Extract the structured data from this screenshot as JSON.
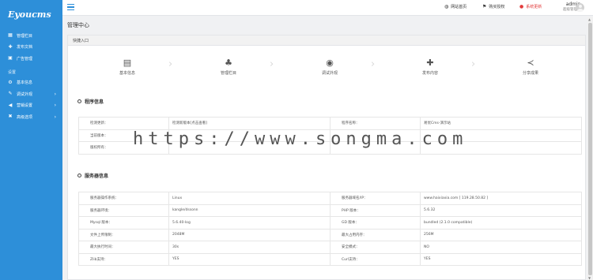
{
  "app": {
    "logo": "Eyoucms"
  },
  "sidebar": {
    "items": [
      {
        "label": "管理栏目",
        "icon": "grid-icon"
      },
      {
        "label": "发布文档",
        "icon": "plus-icon"
      },
      {
        "label": "广告管理",
        "icon": "image-icon"
      }
    ],
    "section_label": "设置",
    "settings": [
      {
        "label": "基本信息",
        "icon": "gear-icon"
      },
      {
        "label": "调试外观",
        "icon": "pen-icon"
      },
      {
        "label": "营销设置",
        "icon": "megaphone-icon"
      },
      {
        "label": "高级选项",
        "icon": "tools-icon"
      }
    ]
  },
  "topbar": {
    "home": "网站首页",
    "buy": "购买授权",
    "update": "系统更新",
    "user_name": "admin",
    "user_role": "超级管理员"
  },
  "main": {
    "title": "管理中心",
    "quick": {
      "heading": "快捷入口",
      "items": [
        {
          "label": "基本信息",
          "icon": "id-card-icon"
        },
        {
          "label": "管理栏目",
          "icon": "sitemap-icon"
        },
        {
          "label": "调试外观",
          "icon": "palette-icon"
        },
        {
          "label": "发布内容",
          "icon": "plus-icon"
        },
        {
          "label": "分享成果",
          "icon": "share-icon"
        }
      ]
    },
    "program": {
      "heading": "程序信息",
      "rows": [
        {
          "k1": "检测更新：",
          "v1": "检测新版本[点击查看]",
          "k2": "程序名称：",
          "v2": "易优Cms-演示站"
        },
        {
          "k1": "当前版本：",
          "v1": "",
          "k2": "",
          "v2": ""
        },
        {
          "k1": "版权所有：",
          "v1": "",
          "k2": "",
          "v2": ""
        }
      ]
    },
    "server": {
      "heading": "服务器信息",
      "rows": [
        {
          "k1": "服务器操作系统：",
          "v1": "Linux",
          "k2": "服务器域名/IP：",
          "v2": "www.haixiaxia.com [ 119.28.50.82 ]"
        },
        {
          "k1": "服务器环境：",
          "v1": "kangle/dssonn",
          "k2": "PHP 版本：",
          "v2": "5.6.32"
        },
        {
          "k1": "Mysql 版本：",
          "v1": "5.6.40-log",
          "k2": "GD 版本：",
          "v2": "bundled (2.1.0 compatible)"
        },
        {
          "k1": "文件上传限制：",
          "v1": "2048M",
          "k2": "最大占用内存：",
          "v2": "256M"
        },
        {
          "k1": "最大执行时间：",
          "v1": "30s",
          "k2": "安全模式：",
          "v2": "NO"
        },
        {
          "k1": "Zlib支持：",
          "v1": "YES",
          "k2": "Curl支持：",
          "v2": "YES"
        }
      ]
    }
  },
  "watermark": "https://www.songma.com",
  "colors": {
    "sidebar": "#2d8fd9",
    "alert": "#e23b3b",
    "panel_bg": "#ffffff",
    "page_bg": "#f0f1f3"
  }
}
